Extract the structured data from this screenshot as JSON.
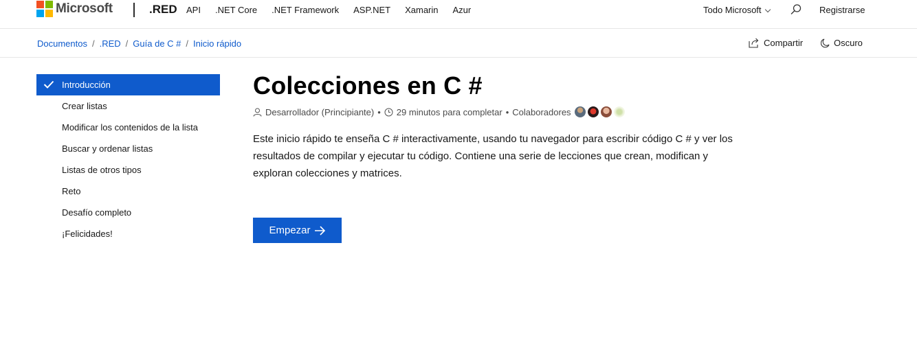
{
  "header": {
    "brand": "Microsoft",
    "product": ".RED",
    "nav": [
      "API",
      ".NET Core",
      ".NET Framework",
      "ASP.NET",
      "Xamarin",
      "Azur"
    ],
    "all_microsoft": "Todo Microsoft",
    "sign_in": "Registrarse",
    "logo_colors": [
      "#f25022",
      "#7fba00",
      "#00a4ef",
      "#ffb900"
    ]
  },
  "breadcrumb": [
    "Documentos",
    ".RED",
    "Guía de C #",
    "Inicio rápido"
  ],
  "actions": {
    "share": "Compartir",
    "theme": "Oscuro"
  },
  "sidebar": {
    "items": [
      {
        "label": "Introducción",
        "active": true
      },
      {
        "label": "Crear listas"
      },
      {
        "label": "Modificar los contenidos de la lista"
      },
      {
        "label": "Buscar y ordenar listas"
      },
      {
        "label": "Listas de otros tipos"
      },
      {
        "label": "Reto"
      },
      {
        "label": "Desafío completo"
      },
      {
        "label": "¡Felicidades!"
      }
    ]
  },
  "main": {
    "title": "Colecciones en C #",
    "meta": {
      "level": "Desarrollador (Principiante)",
      "separator": "•",
      "duration": "29 minutos para completar",
      "contributors": "Colaboradores"
    },
    "intro": "Este inicio rápido te enseña C # interactivamente, usando tu navegador para escribir código C # y ver los resultados de compilar y ejecutar tu código. Contiene una serie de lecciones que crean, modifican y exploran colecciones y matrices.",
    "start_button": "Empezar"
  },
  "colors": {
    "accent": "#0f5bcc"
  }
}
